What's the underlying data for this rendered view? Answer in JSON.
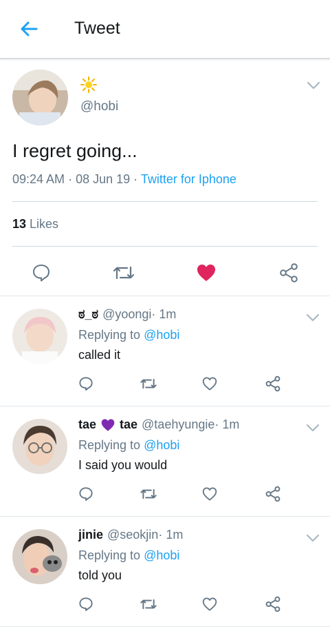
{
  "header": {
    "title": "Tweet",
    "back_icon": "arrow-left-icon",
    "accent": "#1da1f2"
  },
  "main_tweet": {
    "display_name_icon": "sun-emoji-icon",
    "handle": "@hobi",
    "text": "I regret going...",
    "time": "09:24 AM",
    "sep1": " · ",
    "date": "08 Jun 19",
    "sep2": " · ",
    "source": "Twitter for Iphone",
    "likes_count": "13",
    "likes_label": " Likes",
    "liked": true,
    "like_color": "#e0245e"
  },
  "replies": [
    {
      "name": "ಠ_ಠ",
      "handle": "@yoongi",
      "time": " · 1m",
      "replying_label": "Replying to ",
      "mention": "@hobi",
      "text": "called it"
    },
    {
      "name": "tae",
      "name_emoji": "purple-heart-icon",
      "name2": "tae",
      "handle": "@taehyungie",
      "time": " · 1m",
      "replying_label": "Replying to ",
      "mention": "@hobi",
      "text": "I said you would"
    },
    {
      "name": "jinie",
      "handle": "@seokjin",
      "time": " · 1m",
      "replying_label": "Replying to ",
      "mention": "@hobi",
      "text": "told you"
    }
  ]
}
